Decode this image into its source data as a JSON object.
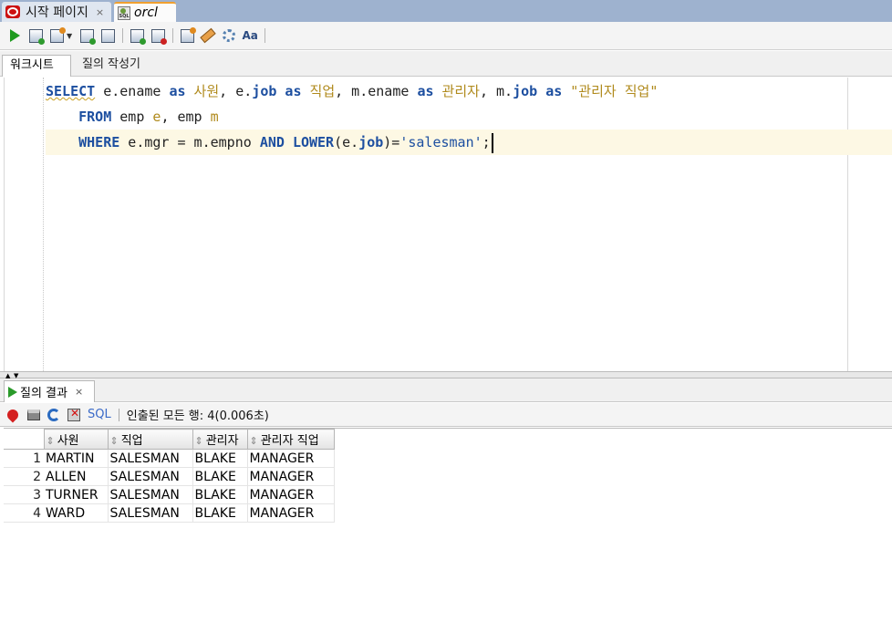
{
  "doc_tabs": [
    {
      "label": "시작 페이지",
      "close": "×"
    },
    {
      "label": "orcl",
      "close": ""
    }
  ],
  "sub_tabs": [
    {
      "label": "워크시트"
    },
    {
      "label": "질의 작성기"
    }
  ],
  "editor": {
    "line1": [
      {
        "t": "SELECT",
        "c": "kw squiggle"
      },
      {
        "t": " e.ename ",
        "c": "plain"
      },
      {
        "t": "as",
        "c": "kw"
      },
      {
        "t": " 사원",
        "c": "alias"
      },
      {
        "t": ", e.",
        "c": "plain"
      },
      {
        "t": "job",
        "c": "kw"
      },
      {
        "t": " ",
        "c": "plain"
      },
      {
        "t": "as",
        "c": "kw"
      },
      {
        "t": " 직업",
        "c": "alias"
      },
      {
        "t": ", m.ename ",
        "c": "plain"
      },
      {
        "t": "as",
        "c": "kw"
      },
      {
        "t": " 관리자",
        "c": "alias"
      },
      {
        "t": ", m.",
        "c": "plain"
      },
      {
        "t": "job",
        "c": "kw"
      },
      {
        "t": " ",
        "c": "plain"
      },
      {
        "t": "as",
        "c": "kw"
      },
      {
        "t": " \"관리자 직업\"",
        "c": "alias"
      }
    ],
    "line2": [
      {
        "t": "    FROM",
        "c": "kw"
      },
      {
        "t": " emp ",
        "c": "plain"
      },
      {
        "t": "e",
        "c": "alias"
      },
      {
        "t": ", emp ",
        "c": "plain"
      },
      {
        "t": "m",
        "c": "alias"
      }
    ],
    "line3": [
      {
        "t": "    WHERE",
        "c": "kw"
      },
      {
        "t": " e.mgr = m.empno ",
        "c": "plain"
      },
      {
        "t": "AND",
        "c": "kw"
      },
      {
        "t": " ",
        "c": "plain"
      },
      {
        "t": "LOWER",
        "c": "kw"
      },
      {
        "t": "(e.",
        "c": "plain"
      },
      {
        "t": "job",
        "c": "kw"
      },
      {
        "t": ")=",
        "c": "plain"
      },
      {
        "t": "'salesman'",
        "c": "str"
      },
      {
        "t": ";",
        "c": "plain"
      }
    ]
  },
  "results": {
    "tab_label": "질의 결과",
    "tab_close": "×",
    "sql_label": "SQL",
    "fetch_status": "인출된 모든 행: 4(0.006초)",
    "sort_glyph": "⇕",
    "columns": [
      "사원",
      "직업",
      "관리자",
      "관리자 직업"
    ],
    "rows": [
      {
        "num": "1",
        "cells": [
          "MARTIN",
          "SALESMAN",
          "BLAKE",
          "MANAGER"
        ]
      },
      {
        "num": "2",
        "cells": [
          "ALLEN",
          "SALESMAN",
          "BLAKE",
          "MANAGER"
        ]
      },
      {
        "num": "3",
        "cells": [
          "TURNER",
          "SALESMAN",
          "BLAKE",
          "MANAGER"
        ]
      },
      {
        "num": "4",
        "cells": [
          "WARD",
          "SALESMAN",
          "BLAKE",
          "MANAGER"
        ]
      }
    ]
  },
  "colors": {
    "keyword": "#1d4fa0",
    "alias": "#b08a1c",
    "current_line": "#fdf8e4",
    "tab_bar": "#9eb2cf"
  }
}
